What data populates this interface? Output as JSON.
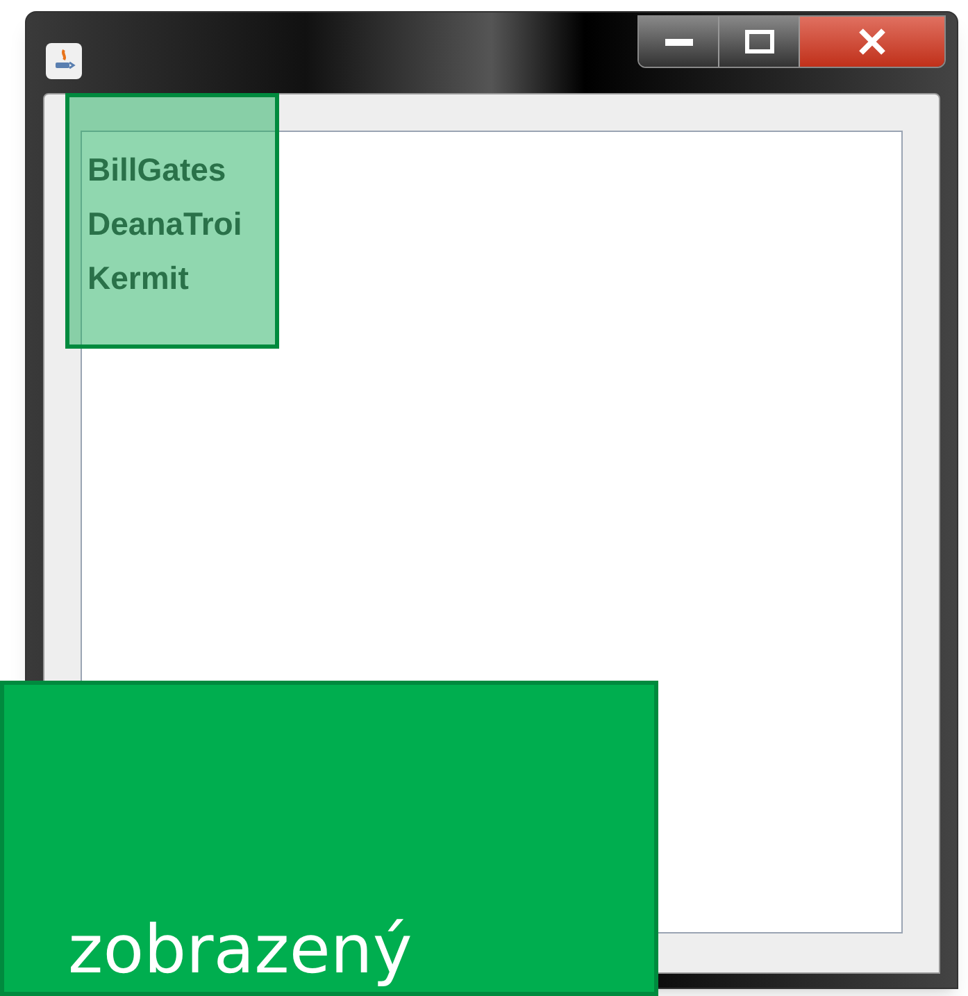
{
  "window": {
    "controls": [
      {
        "kind": "minimize"
      },
      {
        "kind": "maximize"
      },
      {
        "kind": "close"
      }
    ]
  },
  "list": {
    "items": [
      "BillGates",
      "DeanaTroi",
      "Kermit"
    ]
  },
  "callout": {
    "text": "zobrazený"
  }
}
